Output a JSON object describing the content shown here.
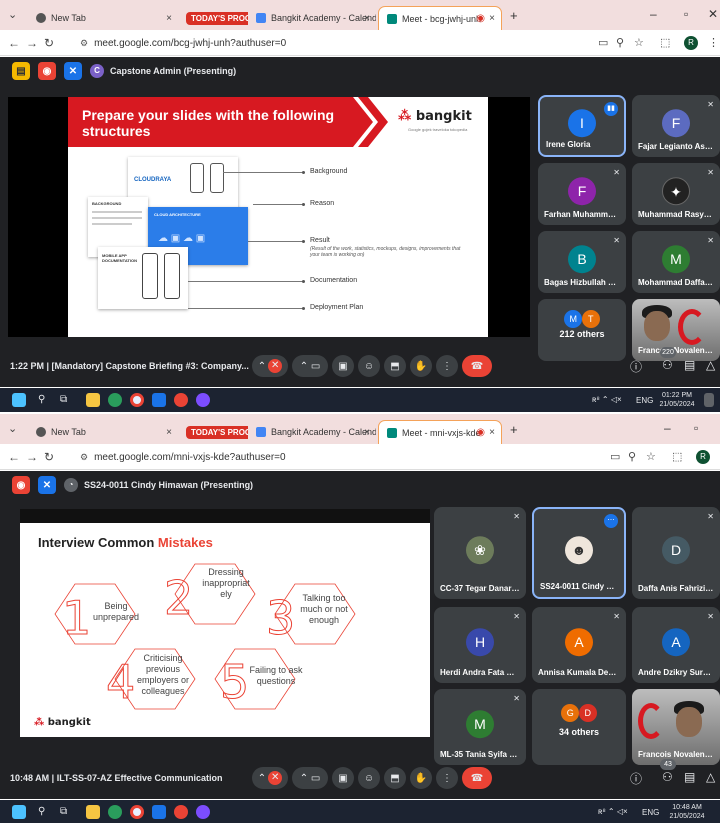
{
  "shot1": {
    "tabs": [
      {
        "label": "New Tab",
        "active": false
      },
      {
        "label": "TODAY'S PROGRAM",
        "group": true
      },
      {
        "label": "Bangkit Academy - Calendar - ",
        "active": false
      },
      {
        "label": "Meet - bcg-jwhj-unh",
        "active": true
      }
    ],
    "url": "meet.google.com/bcg-jwhj-unh?authuser=0",
    "profile_initial": "R",
    "presenter": "Capstone Admin (Presenting)",
    "presenter_initial": "C",
    "slide": {
      "title": "Prepare your slides with the following structures",
      "brand": "bangkit",
      "brand_sub": "Google  gojek  traveloka  tokopedia",
      "items": [
        {
          "label": "Background"
        },
        {
          "label": "Reason"
        },
        {
          "label": "Result",
          "sub": "(Result of the work, statistics, mockups, designs, improvements that your team is working on)"
        },
        {
          "label": "Documentation"
        },
        {
          "label": "Deployment Plan"
        }
      ],
      "card_texts": {
        "cloudraya": "CLOUDRAYA",
        "background": "BACKGROUND",
        "cloud_arch": "CLOUD ARCHITECTURE",
        "mobile": "MOBILE APP DOCUMENTATION"
      }
    },
    "participants": [
      {
        "name": "Irene Gloria",
        "initial": "I",
        "color": "#1a73e8",
        "speaking": true
      },
      {
        "name": "Fajar Legianto Asmi...",
        "initial": "F",
        "color": "#5c6bc0"
      },
      {
        "name": "Farhan Muhammad ...",
        "initial": "F",
        "color": "#8e24aa"
      },
      {
        "name": "Muhammad Rasyid ...",
        "initial": "",
        "color": "#3c4043"
      },
      {
        "name": "Bagas Hizbullah C0...",
        "initial": "B",
        "color": "#00838f"
      },
      {
        "name": "Mohammad Daffa S...",
        "initial": "M",
        "color": "#2e7d32"
      }
    ],
    "others": {
      "label": "212 others",
      "a": "M",
      "b": "T"
    },
    "camera_name": "Francois Novalentin...",
    "ctrl_title": "1:22 PM  |  [Mandatory] Capstone Briefing #3: Company...",
    "people_count": "220",
    "clock_time": "01:22 PM",
    "clock_date": "21/05/2024",
    "lang": "ENG"
  },
  "shot2": {
    "tabs": [
      {
        "label": "New Tab",
        "active": false
      },
      {
        "label": "TODAY'S PROGRAM",
        "group": true
      },
      {
        "label": "Bangkit Academy - Calendar - ",
        "active": false
      },
      {
        "label": "Meet - mni-vxjs-kde",
        "active": true
      }
    ],
    "url": "meet.google.com/mni-vxjs-kde?authuser=0",
    "profile_initial": "R",
    "presenter": "SS24-0011 Cindy Himawan (Presenting)",
    "slide": {
      "title_a": "Interview Common ",
      "title_b": "Mistakes",
      "brand": "bangkit",
      "mistakes": [
        {
          "num": "1",
          "text": "Being unprepared"
        },
        {
          "num": "2",
          "text": "Dressing inappropriat ely"
        },
        {
          "num": "3",
          "text": "Talking too much or not enough"
        },
        {
          "num": "4",
          "text": "Criticising previous employers or colleagues"
        },
        {
          "num": "5",
          "text": "Failing to ask questions"
        }
      ]
    },
    "participants": [
      {
        "name": "CC-37 Tegar Danard...",
        "initial": "",
        "color": "#3c4043"
      },
      {
        "name": "SS24-0011 Cindy Hi...",
        "initial": "",
        "color": "#3c4043",
        "speaking": true
      },
      {
        "name": "Daffa Anis Fahrizi C...",
        "initial": "D",
        "color": "#455a64"
      },
      {
        "name": "Herdi Andra Fata Riz...",
        "initial": "H",
        "color": "#3949ab"
      },
      {
        "name": "Annisa Kumala Dewi ...",
        "initial": "A",
        "color": "#ef6c00"
      },
      {
        "name": "Andre Dzikry Surya ...",
        "initial": "A",
        "color": "#1565c0"
      },
      {
        "name": "ML-35 Tania Syifa Ut...",
        "initial": "M",
        "color": "#2e7d32"
      }
    ],
    "others": {
      "label": "34 others",
      "a": "G",
      "b": "D"
    },
    "camera_name": "Francois Novalentin...",
    "ctrl_title": "10:48 AM  |  ILT-SS-07-AZ Effective Communication",
    "people_count": "43",
    "clock_time": "10:48 AM",
    "clock_date": "21/05/2024",
    "lang": "ENG"
  },
  "colors": {
    "accent_red": "#ea4335",
    "meet_bg": "#202124",
    "tile_bg": "#3c4043",
    "tab_active_border": "#f4a259"
  }
}
